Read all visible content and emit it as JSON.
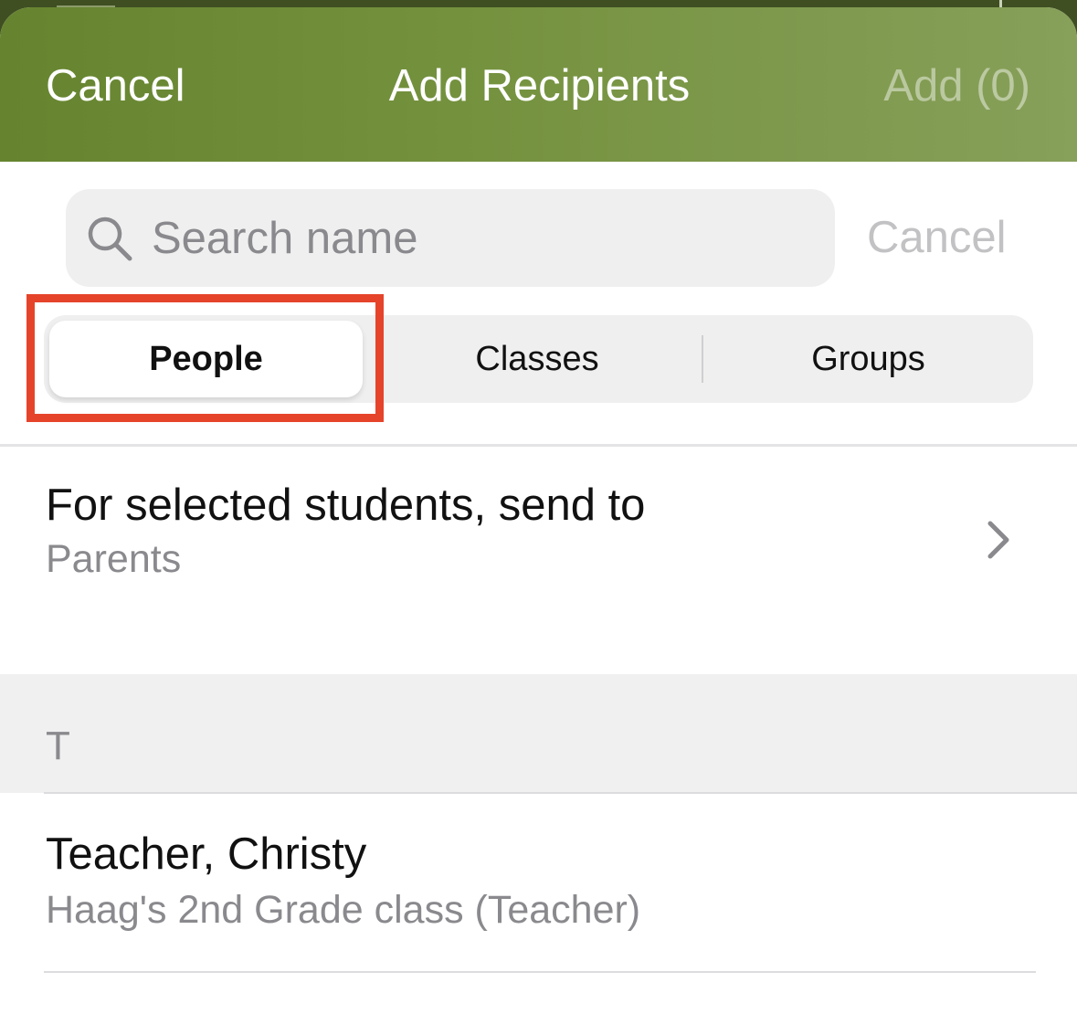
{
  "header": {
    "cancel_label": "Cancel",
    "title": "Add Recipients",
    "add_label": "Add (0)"
  },
  "search": {
    "placeholder": "Search name",
    "value": "",
    "cancel_label": "Cancel"
  },
  "segments": {
    "selected": "People",
    "items": [
      "People",
      "Classes",
      "Groups"
    ]
  },
  "send_to": {
    "title": "For selected students, send to",
    "value": "Parents"
  },
  "sections": [
    {
      "letter": "T",
      "people": [
        {
          "name": "Teacher, Christy",
          "detail": "Haag's 2nd Grade class (Teacher)"
        }
      ]
    }
  ],
  "colors": {
    "header_start": "#66842f",
    "header_end": "#87a05a",
    "highlight": "#e5442b"
  },
  "icons": {
    "search": "search-icon",
    "chevron": "chevron-right-icon"
  }
}
